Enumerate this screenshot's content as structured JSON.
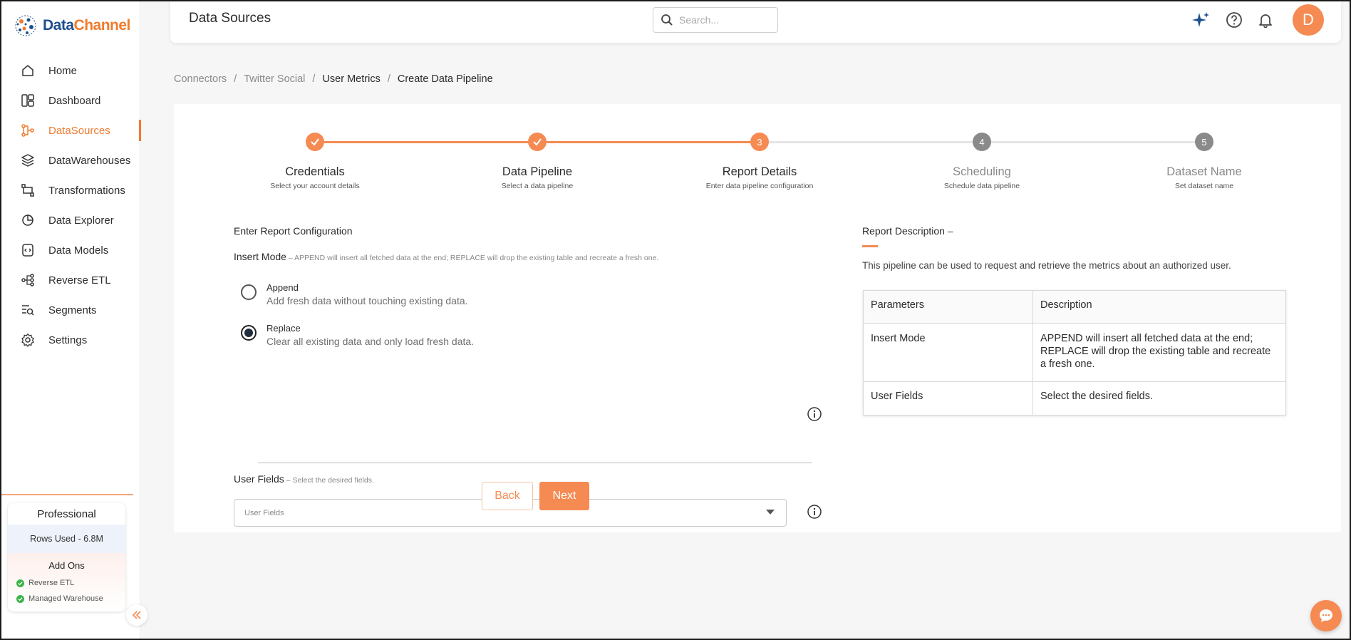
{
  "app": {
    "logo_part1": "Data",
    "logo_part2": "Channel",
    "brand_color": "#f58a52"
  },
  "header": {
    "title": "Data Sources",
    "search_placeholder": "Search...",
    "avatar_initial": "D"
  },
  "sidebar": {
    "items": [
      {
        "label": "Home",
        "icon": "home-icon"
      },
      {
        "label": "Dashboard",
        "icon": "dashboard-icon"
      },
      {
        "label": "DataSources",
        "icon": "datasources-icon",
        "active": true
      },
      {
        "label": "DataWarehouses",
        "icon": "layers-icon"
      },
      {
        "label": "Transformations",
        "icon": "transform-icon"
      },
      {
        "label": "Data Explorer",
        "icon": "explorer-icon"
      },
      {
        "label": "Data Models",
        "icon": "models-icon"
      },
      {
        "label": "Reverse ETL",
        "icon": "reverse-etl-icon"
      },
      {
        "label": "Segments",
        "icon": "segments-icon"
      },
      {
        "label": "Settings",
        "icon": "settings-icon"
      }
    ],
    "plan": {
      "name": "Professional",
      "rows_used": "Rows Used - 6.8M",
      "addons_title": "Add Ons",
      "addons": [
        "Reverse ETL",
        "Managed Warehouse"
      ]
    }
  },
  "breadcrumb": {
    "items": [
      "Connectors",
      "Twitter Social",
      "User Metrics",
      "Create Data Pipeline"
    ],
    "separator": "/"
  },
  "stepper": {
    "steps": [
      {
        "title": "Credentials",
        "subtitle": "Select your account details",
        "state": "done",
        "number": "1"
      },
      {
        "title": "Data Pipeline",
        "subtitle": "Select a data pipeline",
        "state": "done",
        "number": "2"
      },
      {
        "title": "Report Details",
        "subtitle": "Enter data pipeline configuration",
        "state": "current",
        "number": "3"
      },
      {
        "title": "Scheduling",
        "subtitle": "Schedule data pipeline",
        "state": "todo",
        "number": "4"
      },
      {
        "title": "Dataset Name",
        "subtitle": "Set dataset name",
        "state": "todo",
        "number": "5"
      }
    ]
  },
  "form": {
    "heading": "Enter Report Configuration",
    "insert_mode_label": "Insert Mode",
    "insert_mode_hint": " – APPEND will insert all fetched data at the end; REPLACE will drop the existing table and recreate a fresh one.",
    "options": [
      {
        "title": "Append",
        "description": "Add fresh data without touching existing data.",
        "selected": false
      },
      {
        "title": "Replace",
        "description": "Clear all existing data and only load fresh data.",
        "selected": true
      }
    ],
    "user_fields_label": "User Fields",
    "user_fields_hint": " – Select the desired fields.",
    "user_fields_placeholder": "User Fields",
    "back_label": "Back",
    "next_label": "Next"
  },
  "description": {
    "title": "Report Description –",
    "text": "This pipeline can be used to request and retrieve the metrics about an authorized user.",
    "table": {
      "headers": [
        "Parameters",
        "Description"
      ],
      "rows": [
        [
          "Insert Mode",
          "APPEND will insert all fetched data at the end; REPLACE will drop the existing table and recreate a fresh one."
        ],
        [
          "User Fields",
          "Select the desired fields."
        ]
      ]
    }
  }
}
